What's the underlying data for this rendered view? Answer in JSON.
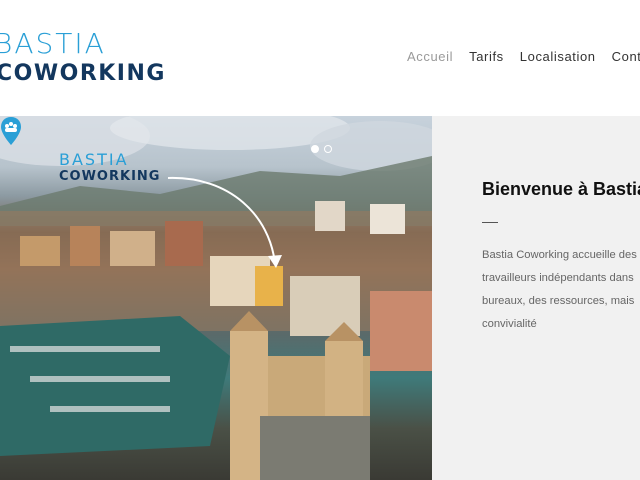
{
  "logo": {
    "line1": "BASTIA",
    "line2": "COWORKING"
  },
  "nav": {
    "items": [
      "Accueil",
      "Tarifs",
      "Localisation",
      "Contact"
    ],
    "active_index": 0
  },
  "hero": {
    "logo_line1": "BASTIA",
    "logo_line2": "COWORKING",
    "slide_count": 2,
    "active_slide": 1
  },
  "welcome": {
    "title": "Bienvenue à Bastia Coworking",
    "lines": [
      "Bastia Coworking accueille des",
      "travailleurs indépendants dans",
      "bureaux, des ressources, mais",
      "convivialité"
    ]
  },
  "colors": {
    "brand_light": "#2a9fd6",
    "brand_dark": "#13375e",
    "panel_bg": "#f1f1f1"
  }
}
